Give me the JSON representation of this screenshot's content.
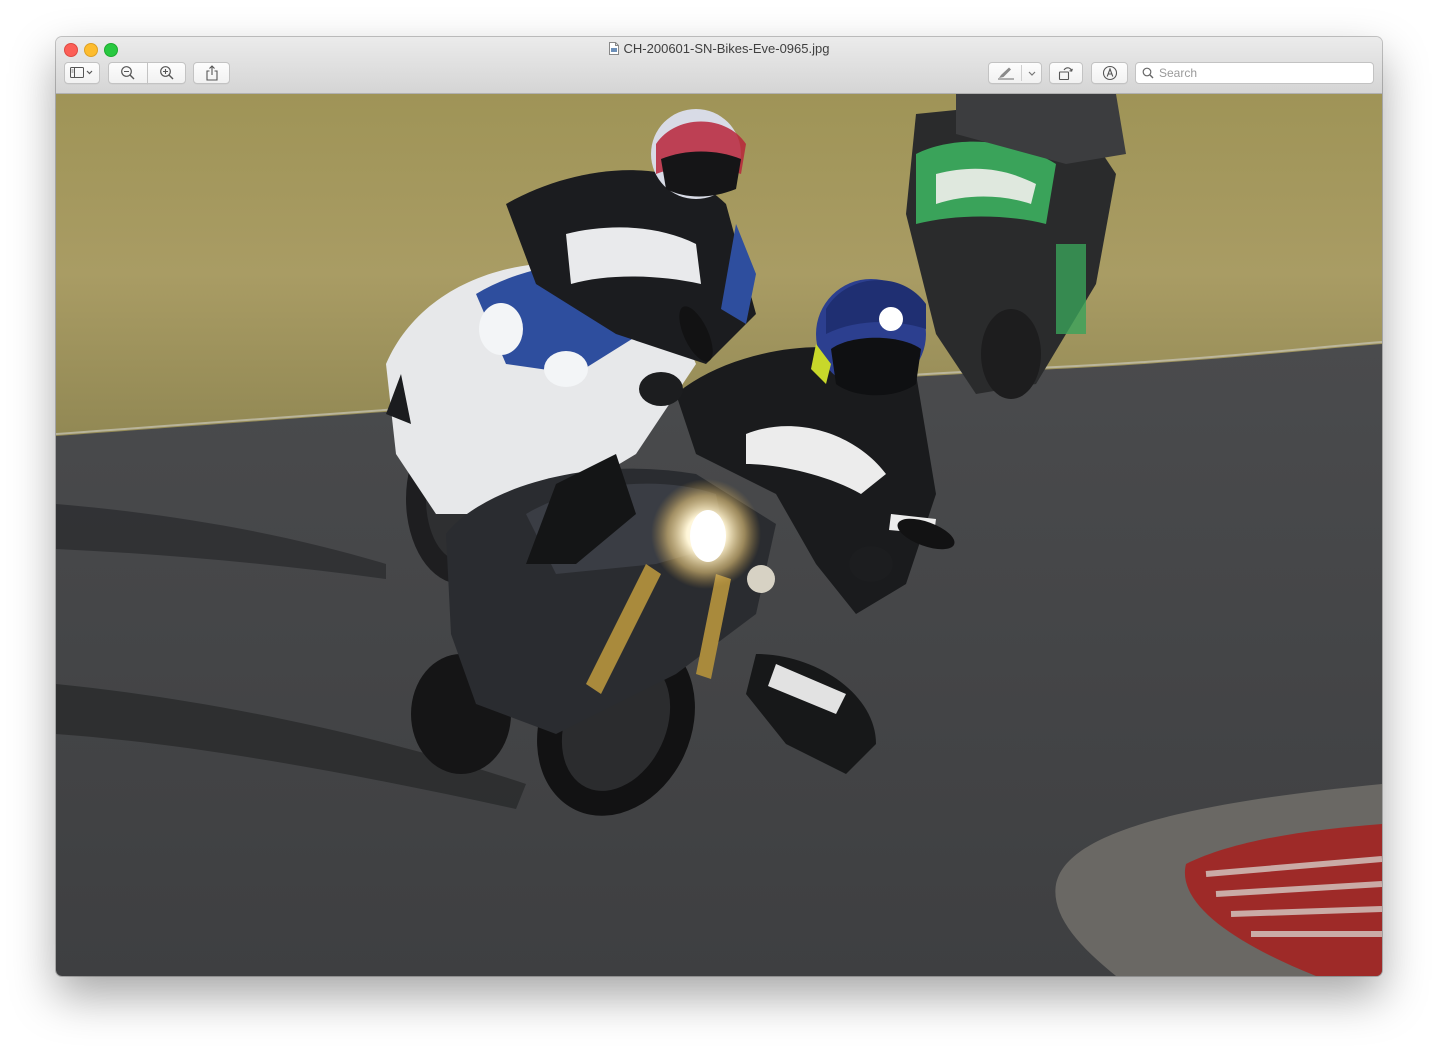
{
  "window": {
    "title": "CH-200601-SN-Bikes-Eve-0965.jpg"
  },
  "toolbar": {
    "sidebar_icon": "sidebar-icon",
    "zoom_out_icon": "zoom-out-icon",
    "zoom_in_icon": "zoom-in-icon",
    "share_icon": "share-icon",
    "markup_icon": "pen-icon",
    "rotate_icon": "rotate-icon",
    "annotate_icon": "markup-circle-icon"
  },
  "search": {
    "placeholder": "Search"
  },
  "colors": {
    "grass": "#a59a63",
    "track": "#434446",
    "curb_red": "#9e2a28"
  }
}
